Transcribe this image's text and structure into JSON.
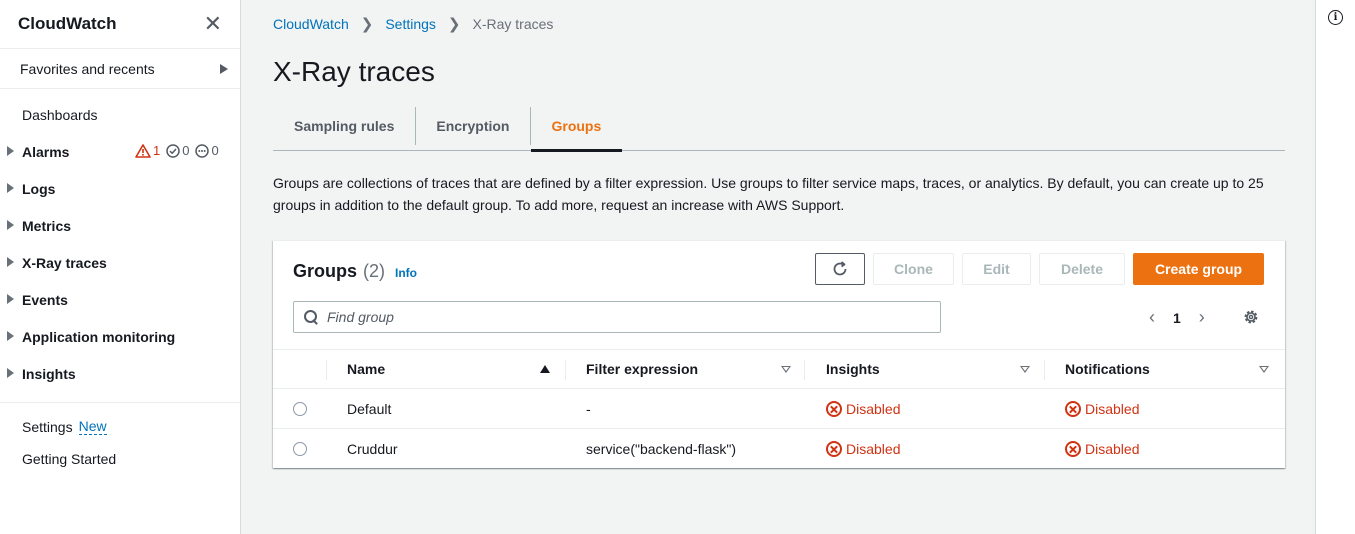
{
  "sidebar": {
    "title": "CloudWatch",
    "close_label": "✕",
    "favorites_label": "Favorites and recents",
    "dashboards": "Dashboards",
    "items": [
      {
        "label": "Alarms"
      },
      {
        "label": "Logs"
      },
      {
        "label": "Metrics"
      },
      {
        "label": "X-Ray traces"
      },
      {
        "label": "Events"
      },
      {
        "label": "Application monitoring"
      },
      {
        "label": "Insights"
      }
    ],
    "alarm_badges": {
      "in_alarm": "1",
      "ok": "0",
      "insufficient": "0"
    },
    "settings": "Settings",
    "settings_new": "New",
    "getting_started": "Getting Started"
  },
  "breadcrumb": [
    "CloudWatch",
    "Settings",
    "X-Ray traces"
  ],
  "page_title": "X-Ray traces",
  "tabs": [
    {
      "label": "Sampling rules",
      "active": false
    },
    {
      "label": "Encryption",
      "active": false
    },
    {
      "label": "Groups",
      "active": true
    }
  ],
  "description": "Groups are collections of traces that are defined by a filter expression. Use groups to filter service maps, traces, or analytics. By default, you can create up to 25 groups in addition to the default group. To add more, request an increase with AWS Support.",
  "panel": {
    "title": "Groups",
    "count": "(2)",
    "info": "Info",
    "buttons": {
      "clone": "Clone",
      "edit": "Edit",
      "delete": "Delete",
      "create": "Create group"
    },
    "search_placeholder": "Find group",
    "page": "1"
  },
  "table": {
    "columns": [
      "Name",
      "Filter expression",
      "Insights",
      "Notifications"
    ],
    "rows": [
      {
        "name": "Default",
        "filter": "-",
        "insights": "Disabled",
        "notifications": "Disabled"
      },
      {
        "name": "Cruddur",
        "filter": "service(\"backend-flask\")",
        "insights": "Disabled",
        "notifications": "Disabled"
      }
    ]
  },
  "colors": {
    "accent": "#ec7211",
    "link": "#0073bb",
    "error": "#d13212"
  }
}
